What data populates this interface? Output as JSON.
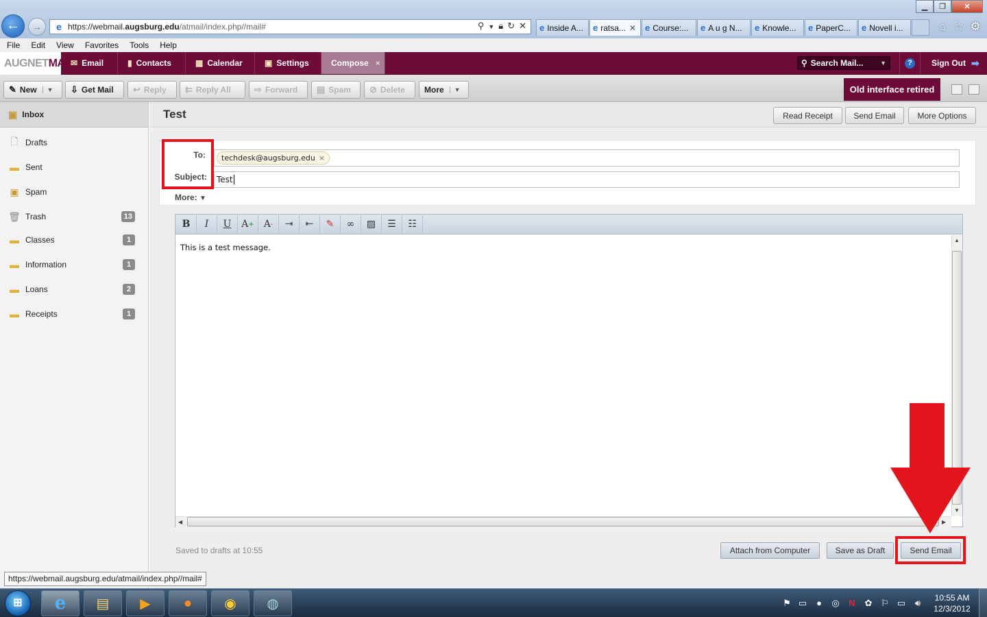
{
  "browser": {
    "url_prefix": "https://webmail.",
    "url_domain": "augsburg.edu",
    "url_path": "/atmail/index.php//mail#",
    "tabs": [
      {
        "label": "Inside A..."
      },
      {
        "label": "ratsa...",
        "active": true
      },
      {
        "label": "Course:..."
      },
      {
        "label": "A u g N..."
      },
      {
        "label": "Knowle..."
      },
      {
        "label": "PaperC..."
      },
      {
        "label": "Novell i..."
      }
    ],
    "menu": [
      "File",
      "Edit",
      "View",
      "Favorites",
      "Tools",
      "Help"
    ],
    "status_url": "https://webmail.augsburg.edu/atmail/index.php//mail#"
  },
  "app": {
    "brand_augnet": "AUGNET",
    "brand_mail": "MAIL",
    "nav": {
      "email": "Email",
      "contacts": "Contacts",
      "calendar": "Calendar",
      "settings": "Settings",
      "compose": "Compose"
    },
    "search_label": "Search Mail...",
    "sign_out": "Sign Out"
  },
  "toolbar": {
    "new": "New",
    "get_mail": "Get Mail",
    "reply": "Reply",
    "reply_all": "Reply All",
    "forward": "Forward",
    "spam": "Spam",
    "delete": "Delete",
    "more": "More",
    "old_interface": "Old interface retired"
  },
  "sidebar": {
    "inbox": "Inbox",
    "folders": [
      {
        "label": "Drafts",
        "count": ""
      },
      {
        "label": "Sent",
        "count": ""
      },
      {
        "label": "Spam",
        "count": ""
      },
      {
        "label": "Trash",
        "count": "13"
      },
      {
        "label": "Classes",
        "count": "1"
      },
      {
        "label": "Information",
        "count": "1"
      },
      {
        "label": "Loans",
        "count": "2"
      },
      {
        "label": "Receipts",
        "count": "1"
      }
    ]
  },
  "compose": {
    "title": "Test",
    "header_buttons": {
      "read_receipt": "Read Receipt",
      "send_email": "Send Email",
      "more_options": "More Options"
    },
    "to_label": "To:",
    "subject_label": "Subject:",
    "recipient": "techdesk@augsburg.edu",
    "subject_value": "Test",
    "more_label": "More:",
    "body_text": "This is a test message.",
    "saved_status": "Saved to drafts at 10:55",
    "footer_buttons": {
      "attach": "Attach from Computer",
      "save_draft": "Save as Draft",
      "send": "Send Email"
    }
  },
  "taskbar": {
    "time": "10:55 AM",
    "date": "12/3/2012"
  },
  "colors": {
    "brand": "#6d0b39",
    "annotation_red": "#e3141b"
  }
}
